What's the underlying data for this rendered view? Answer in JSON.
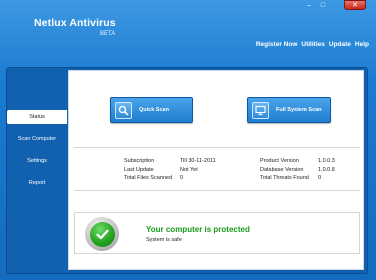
{
  "window": {
    "minimize_label": "–",
    "maximize_label": "□",
    "close_label": "✕"
  },
  "header": {
    "title": "Netlux Antivirus",
    "subtitle": "BETA"
  },
  "topnav": {
    "items": [
      "Register Now",
      "Utilities",
      "Update",
      "Help"
    ]
  },
  "sidebar": {
    "items": [
      {
        "label": "Status",
        "active": true
      },
      {
        "label": "Scan Computer",
        "active": false
      },
      {
        "label": "Settings",
        "active": false
      },
      {
        "label": "Report",
        "active": false
      }
    ]
  },
  "scan": {
    "quick_label": "Quick Scan",
    "full_label": "Full System Scan"
  },
  "info": {
    "subscription_label": "Subscription",
    "subscription_value": "Till 30-11-2011",
    "last_update_label": "Last Update",
    "last_update_value": "Not Yet",
    "files_scanned_label": "Total Files Scanned",
    "files_scanned_value": "0",
    "product_version_label": "Product Version",
    "product_version_value": "1.0.0.3",
    "database_version_label": "Database Version",
    "database_version_value": "1.0.0.8",
    "threats_label": "Total Threats Found",
    "threats_value": "0"
  },
  "status": {
    "headline": "Your computer is protected",
    "detail": "System is safe"
  },
  "colors": {
    "accent": "#1b7bd0",
    "protected_green": "#199c19"
  }
}
